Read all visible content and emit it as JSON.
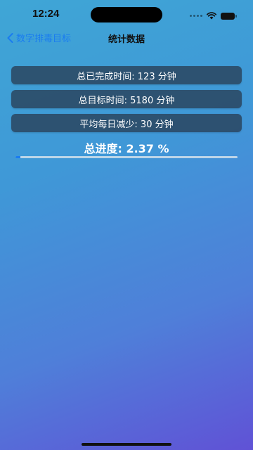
{
  "status_bar": {
    "time": "12:24",
    "icons": [
      "signal-icon",
      "wifi-icon",
      "battery-icon"
    ]
  },
  "nav": {
    "back_label": "数字排毒目标",
    "title": "统计数据"
  },
  "stats": {
    "total_completed": "总已完成时间: 123 分钟",
    "total_target": "总目标时间: 5180 分钟",
    "daily_reduction": "平均每日减少: 30 分钟"
  },
  "progress": {
    "label": "总进度: 2.37 %",
    "fraction": 0.0237
  },
  "colors": {
    "accent": "#1a7cf0",
    "card_bg": "#283e54",
    "gradient_top": "#3fa6d6",
    "gradient_bottom": "#6052d6"
  }
}
